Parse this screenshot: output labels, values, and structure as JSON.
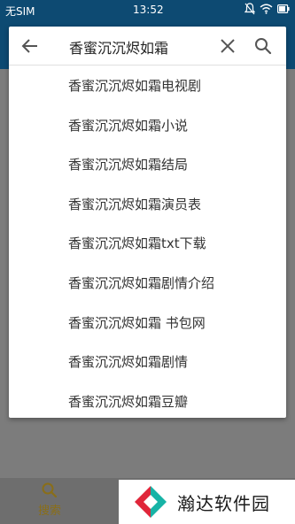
{
  "status_bar": {
    "carrier": "无SIM",
    "time": "13:52",
    "icons": [
      "mute-icon",
      "wifi-icon",
      "battery-icon"
    ]
  },
  "search": {
    "query": "香蜜沉沉烬如霜",
    "icons": {
      "back": "arrow-left-icon",
      "clear": "close-icon",
      "search": "search-icon"
    }
  },
  "suggestions": [
    "香蜜沉沉烬如霜电视剧",
    "香蜜沉沉烬如霜小说",
    "香蜜沉沉烬如霜结局",
    "香蜜沉沉烬如霜演员表",
    "香蜜沉沉烬如霜txt下载",
    "香蜜沉沉烬如霜剧情介绍",
    "香蜜沉沉烬如霜 书包网",
    "香蜜沉沉烬如霜剧情",
    "香蜜沉沉烬如霜豆瓣"
  ],
  "bottom_nav": {
    "search_label": "搜索"
  },
  "watermark": {
    "text": "瀚达软件园"
  },
  "colors": {
    "toolbar": "#0d4a72",
    "overlay": "#7c7c7c",
    "tab_active": "#8a6e18",
    "logo_red": "#e0263a",
    "logo_teal": "#17b3a6"
  }
}
